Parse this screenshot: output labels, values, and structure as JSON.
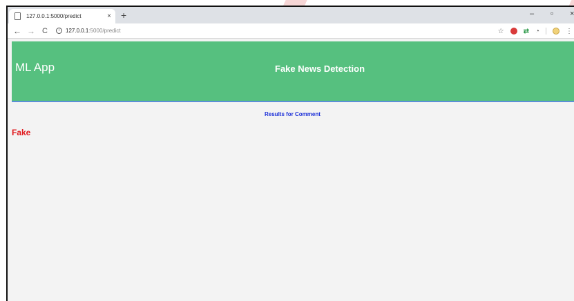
{
  "browser": {
    "tab": {
      "title": "127.0.0.1:5000/predict",
      "close_glyph": "×"
    },
    "new_tab_glyph": "+",
    "window_controls": {
      "minimize": "–",
      "maximize": "▫",
      "close": "×"
    },
    "nav": {
      "back": "←",
      "forward": "→",
      "reload": "C"
    },
    "address": {
      "host": "127.0.0.1",
      "path": ":5000/predict"
    },
    "extensions": {
      "star_glyph": "☆",
      "green_ext_glyph": "⇄",
      "circle_ext_glyph": "◔",
      "menu_glyph": "⋮"
    }
  },
  "page": {
    "header": {
      "brand": "ML App",
      "title": "Fake News Detection",
      "background_color": "#56c07f",
      "border_color": "#5b8fd6"
    },
    "results_heading": "Results for Comment",
    "results_heading_color": "#1b2fd8",
    "prediction": "Fake",
    "prediction_color": "#e0191d"
  },
  "icons": [
    "page-icon",
    "back-arrow-icon",
    "forward-arrow-icon",
    "reload-icon",
    "info-icon",
    "star-icon",
    "adblock-icon",
    "green-extension-icon",
    "circle-extension-icon",
    "profile-icon",
    "menu-icon"
  ]
}
